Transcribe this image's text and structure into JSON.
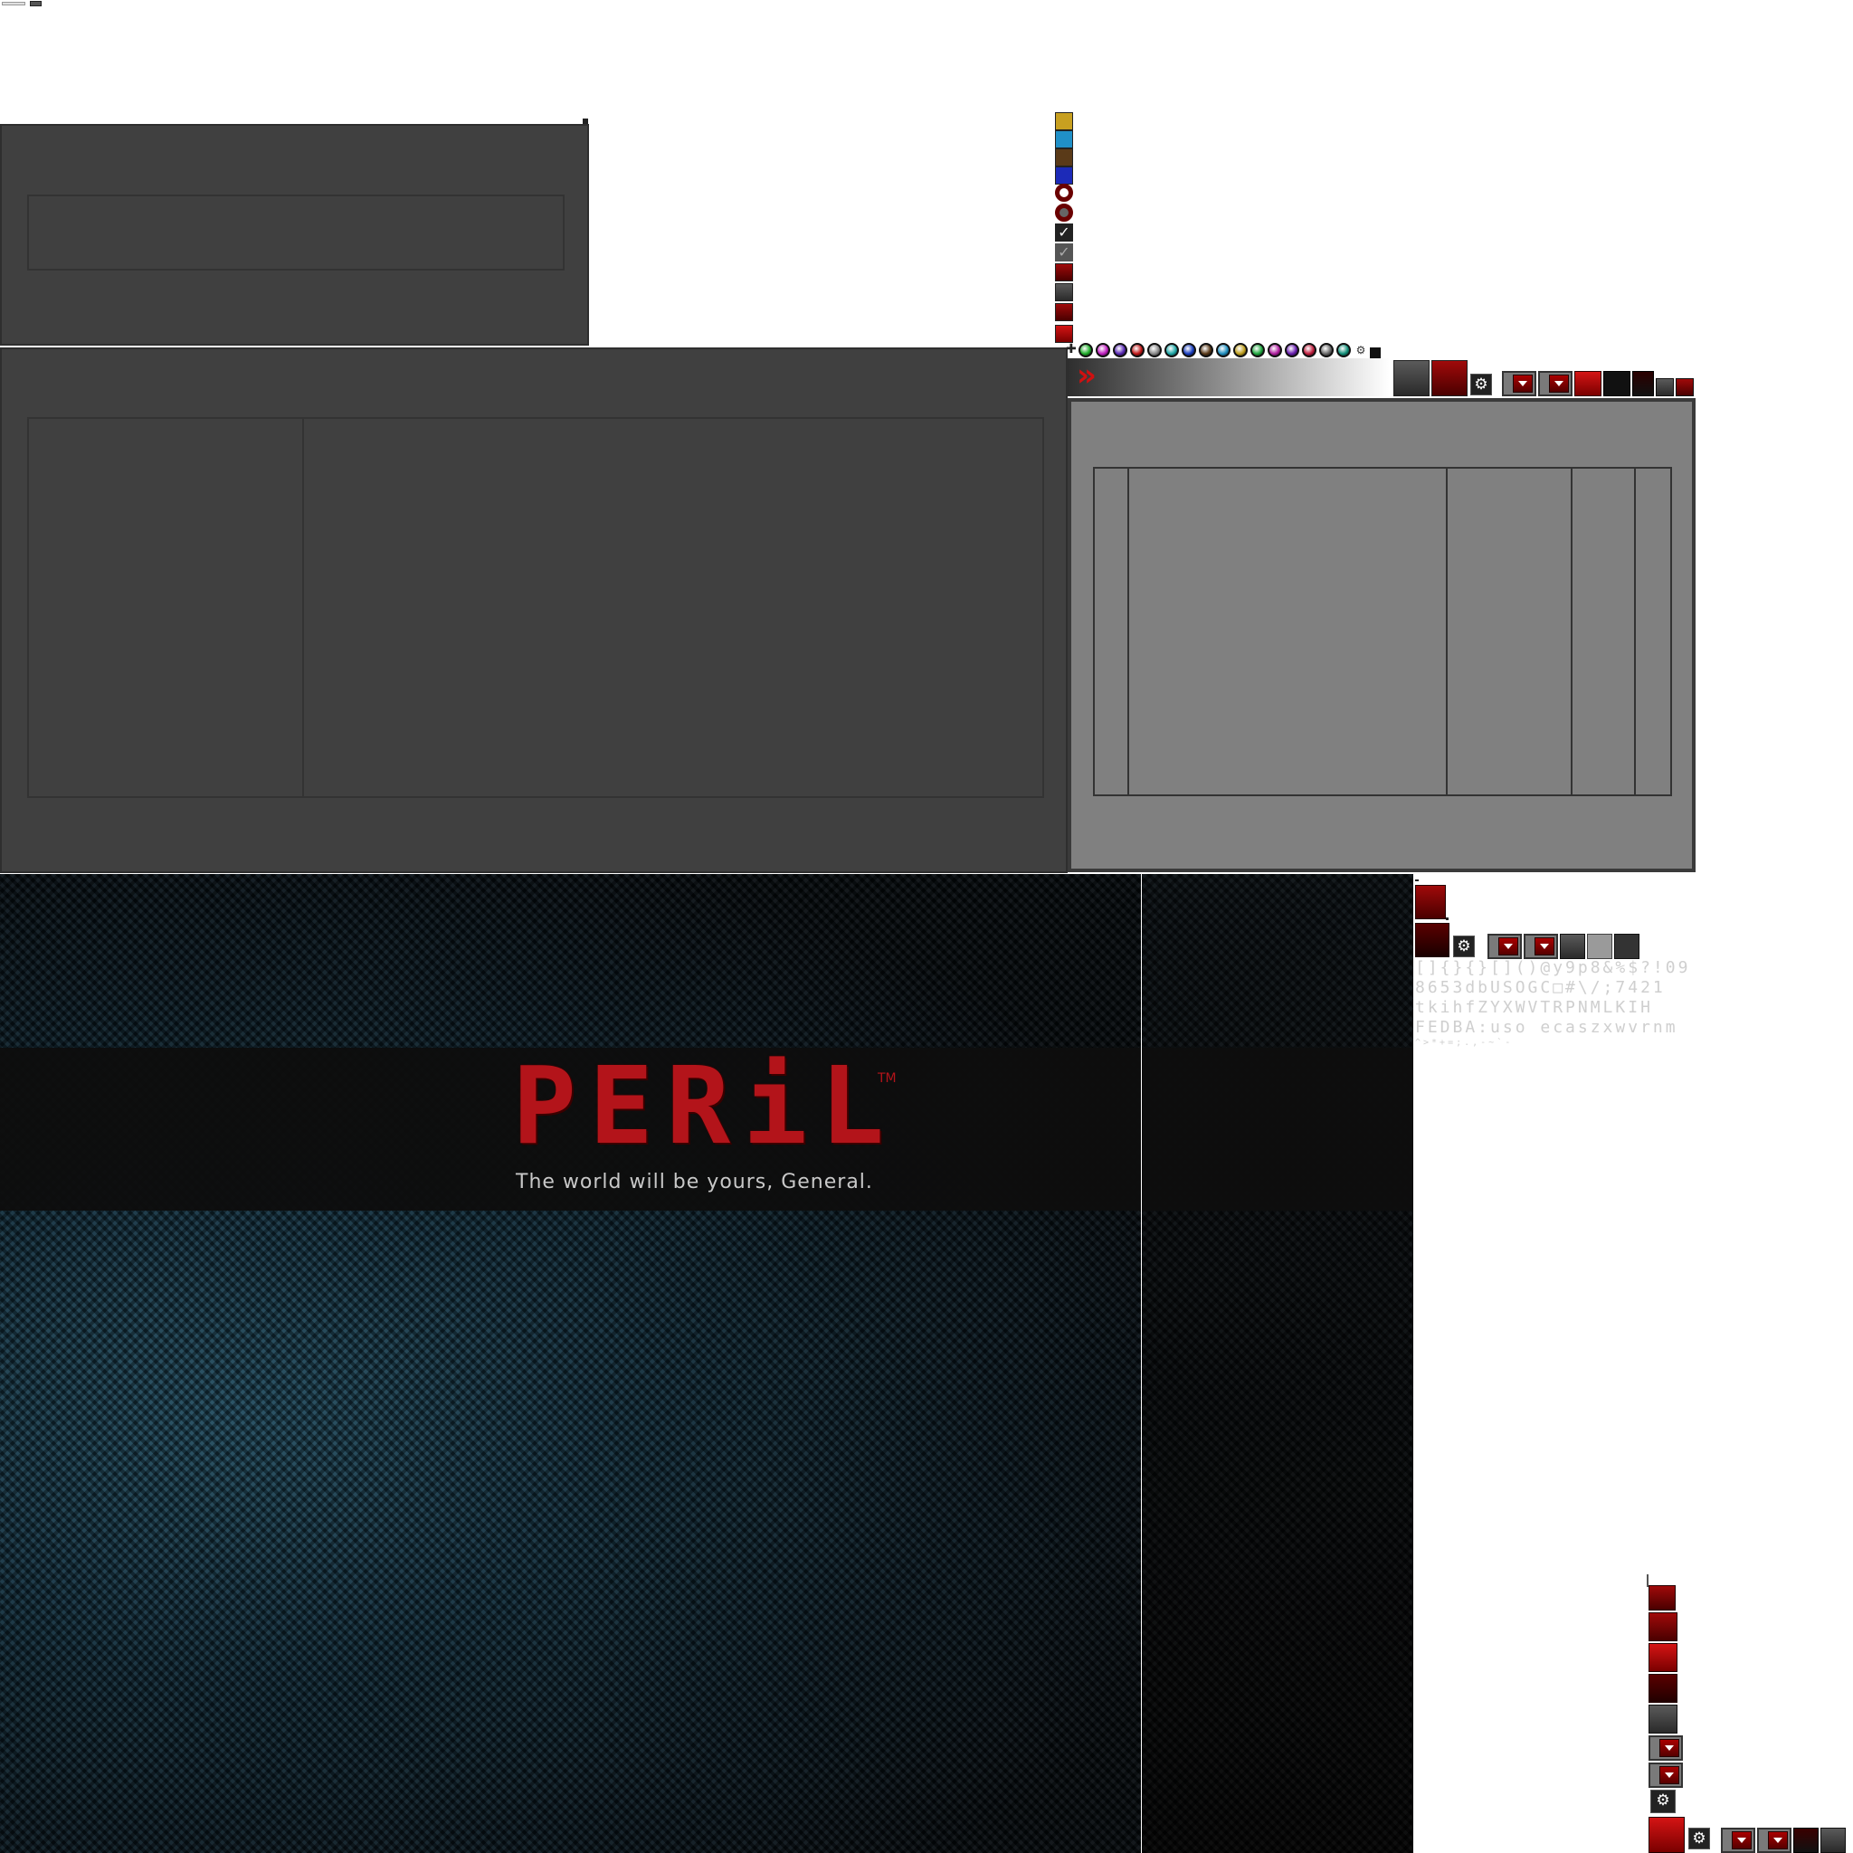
{
  "splash": {
    "logo_text": "PERiL",
    "trademark": "TM",
    "tagline": "The world will be yours, General."
  },
  "font_atlas": {
    "rows": [
      "[]{}{}[]()@y9p8&%$?!09",
      "8653dbUSOGC□#\\/;7421",
      "tkihfZYXWVTRPNMLKIH",
      "FEDBA:uso ecaszxwvrnm",
      "^>*+=;.,-~`-"
    ]
  },
  "swatches": {
    "dots": [
      "#1fae2a",
      "#c01fc0",
      "#5a2ab5",
      "#c01818",
      "#8a8a8a",
      "#1fa8a8",
      "#1a3fc0",
      "#5a3a1a",
      "#1f8fc0",
      "#c0a01f",
      "#1fa83f",
      "#b01fa0",
      "#6a1fb0",
      "#c01f3f",
      "#6a6a6a",
      "#12907a"
    ],
    "vertical": [
      "#c8a020",
      "#2090c8",
      "#5a3a18",
      "#1c2ab8"
    ],
    "accent": "#b3141a"
  },
  "icons": {
    "gear": "⚙",
    "arrows": "»",
    "check": "✓"
  }
}
